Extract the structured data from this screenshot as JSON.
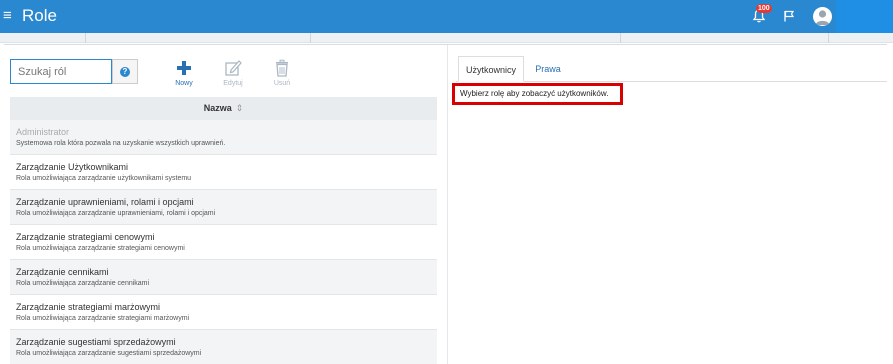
{
  "header": {
    "menu_glyph": "≡",
    "title": "Role",
    "notifications_badge": "100"
  },
  "toolbar": {
    "search_placeholder": "Szukaj ról",
    "help_glyph": "?",
    "new_label": "Nowy",
    "edit_label": "Edytuj",
    "delete_label": "Usuń"
  },
  "table": {
    "column_header": "Nazwa",
    "sort_glyph": "⇕",
    "rows": [
      {
        "name": "Administrator",
        "desc": "Systemowa rola która pozwala na uzyskanie wszystkich uprawnień."
      },
      {
        "name": "Zarządzanie Użytkownikami",
        "desc": "Rola umożliwiająca zarządzanie użytkownikami systemu"
      },
      {
        "name": "Zarządzanie uprawnieniami, rolami i opcjami",
        "desc": "Rola umożliwiająca zarządzanie uprawnieniami, rolami i opcjami"
      },
      {
        "name": "Zarządzanie strategiami cenowymi",
        "desc": "Rola umożliwiająca zarządzanie strategiami cenowymi"
      },
      {
        "name": "Zarządzanie cennikami",
        "desc": "Rola umożliwiająca zarządzanie cennikami"
      },
      {
        "name": "Zarządzanie strategiami marżowymi",
        "desc": "Rola umożliwiająca zarządzanie strategiami marżowymi"
      },
      {
        "name": "Zarządzanie sugestiami sprzedażowymi",
        "desc": "Rola umożliwiająca zarządzanie sugestiami sprzedażowymi"
      }
    ]
  },
  "right_panel": {
    "tabs": [
      {
        "label": "Użytkownicy"
      },
      {
        "label": "Prawa"
      }
    ],
    "notice": "Wybierz rolę aby zobaczyć użytkowników."
  },
  "colors": {
    "header_bg": "#2a88d0",
    "accent": "#2a6fb0",
    "highlight_border": "#d80000",
    "badge": "#e53935"
  }
}
